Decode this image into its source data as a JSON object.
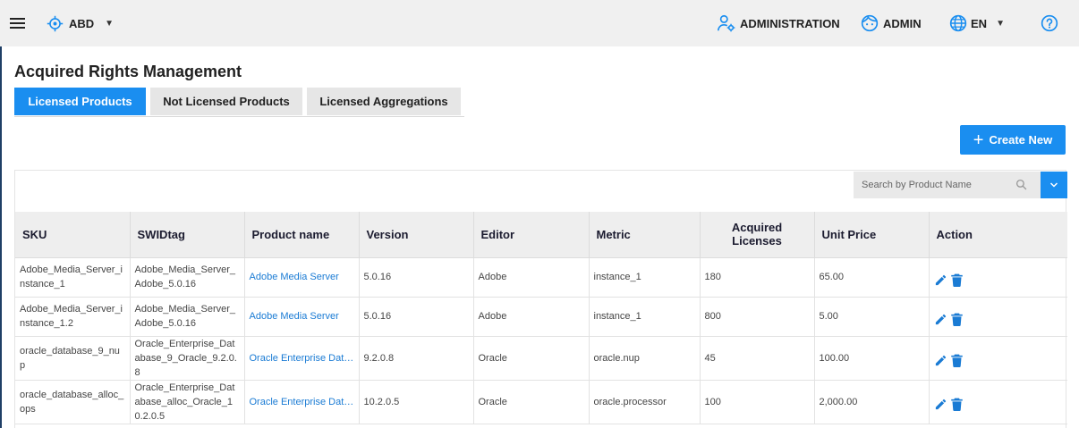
{
  "topbar": {
    "environment": "ABD",
    "administration": "ADMINISTRATION",
    "user": "ADMIN",
    "language": "EN"
  },
  "page": {
    "title": "Acquired Rights Management"
  },
  "tabs": [
    {
      "label": "Licensed Products",
      "active": true
    },
    {
      "label": "Not Licensed Products",
      "active": false
    },
    {
      "label": "Licensed Aggregations",
      "active": false
    }
  ],
  "create_button": {
    "label": "Create New"
  },
  "search": {
    "placeholder": "Search by Product Name"
  },
  "table": {
    "headers": {
      "sku": "SKU",
      "swidtag": "SWIDtag",
      "product_name": "Product name",
      "version": "Version",
      "editor": "Editor",
      "metric": "Metric",
      "acquired_licenses": "Acquired Licenses",
      "unit_price": "Unit Price",
      "action": "Action"
    },
    "rows": [
      {
        "sku": "Adobe_Media_Server_instance_1",
        "swidtag": "Adobe_Media_Server_Adobe_5.0.16",
        "product_name": "Adobe Media Server",
        "version": "5.0.16",
        "editor": "Adobe",
        "metric": "instance_1",
        "acquired_licenses": "180",
        "unit_price": "65.00"
      },
      {
        "sku": "Adobe_Media_Server_instance_1.2",
        "swidtag": "Adobe_Media_Server_Adobe_5.0.16",
        "product_name": "Adobe Media Server",
        "version": "5.0.16",
        "editor": "Adobe",
        "metric": "instance_1",
        "acquired_licenses": "800",
        "unit_price": "5.00"
      },
      {
        "sku": "oracle_database_9_nup",
        "swidtag": "Oracle_Enterprise_Database_9_Oracle_9.2.0.8",
        "product_name": "Oracle Enterprise Database",
        "version": "9.2.0.8",
        "editor": "Oracle",
        "metric": "oracle.nup",
        "acquired_licenses": "45",
        "unit_price": "100.00"
      },
      {
        "sku": "oracle_database_alloc_ops",
        "swidtag": "Oracle_Enterprise_Database_alloc_Oracle_10.2.0.5",
        "product_name": "Oracle Enterprise Database",
        "version": "10.2.0.5",
        "editor": "Oracle",
        "metric": "oracle.processor",
        "acquired_licenses": "100",
        "unit_price": "2,000.00"
      }
    ]
  },
  "icons": {
    "menu": "hamburger-icon",
    "environment": "crosshair-icon",
    "administration": "user-gear-icon",
    "user": "face-icon",
    "language": "globe-icon",
    "help": "question-icon",
    "search": "search-icon",
    "filter": "chevron-down-icon",
    "edit": "pencil-icon",
    "delete": "trash-icon"
  },
  "colors": {
    "accent": "#1a8ef0",
    "link": "#1a7bd4",
    "topbar_bg": "#f0f0f0",
    "header_bg": "#eeeeee"
  }
}
